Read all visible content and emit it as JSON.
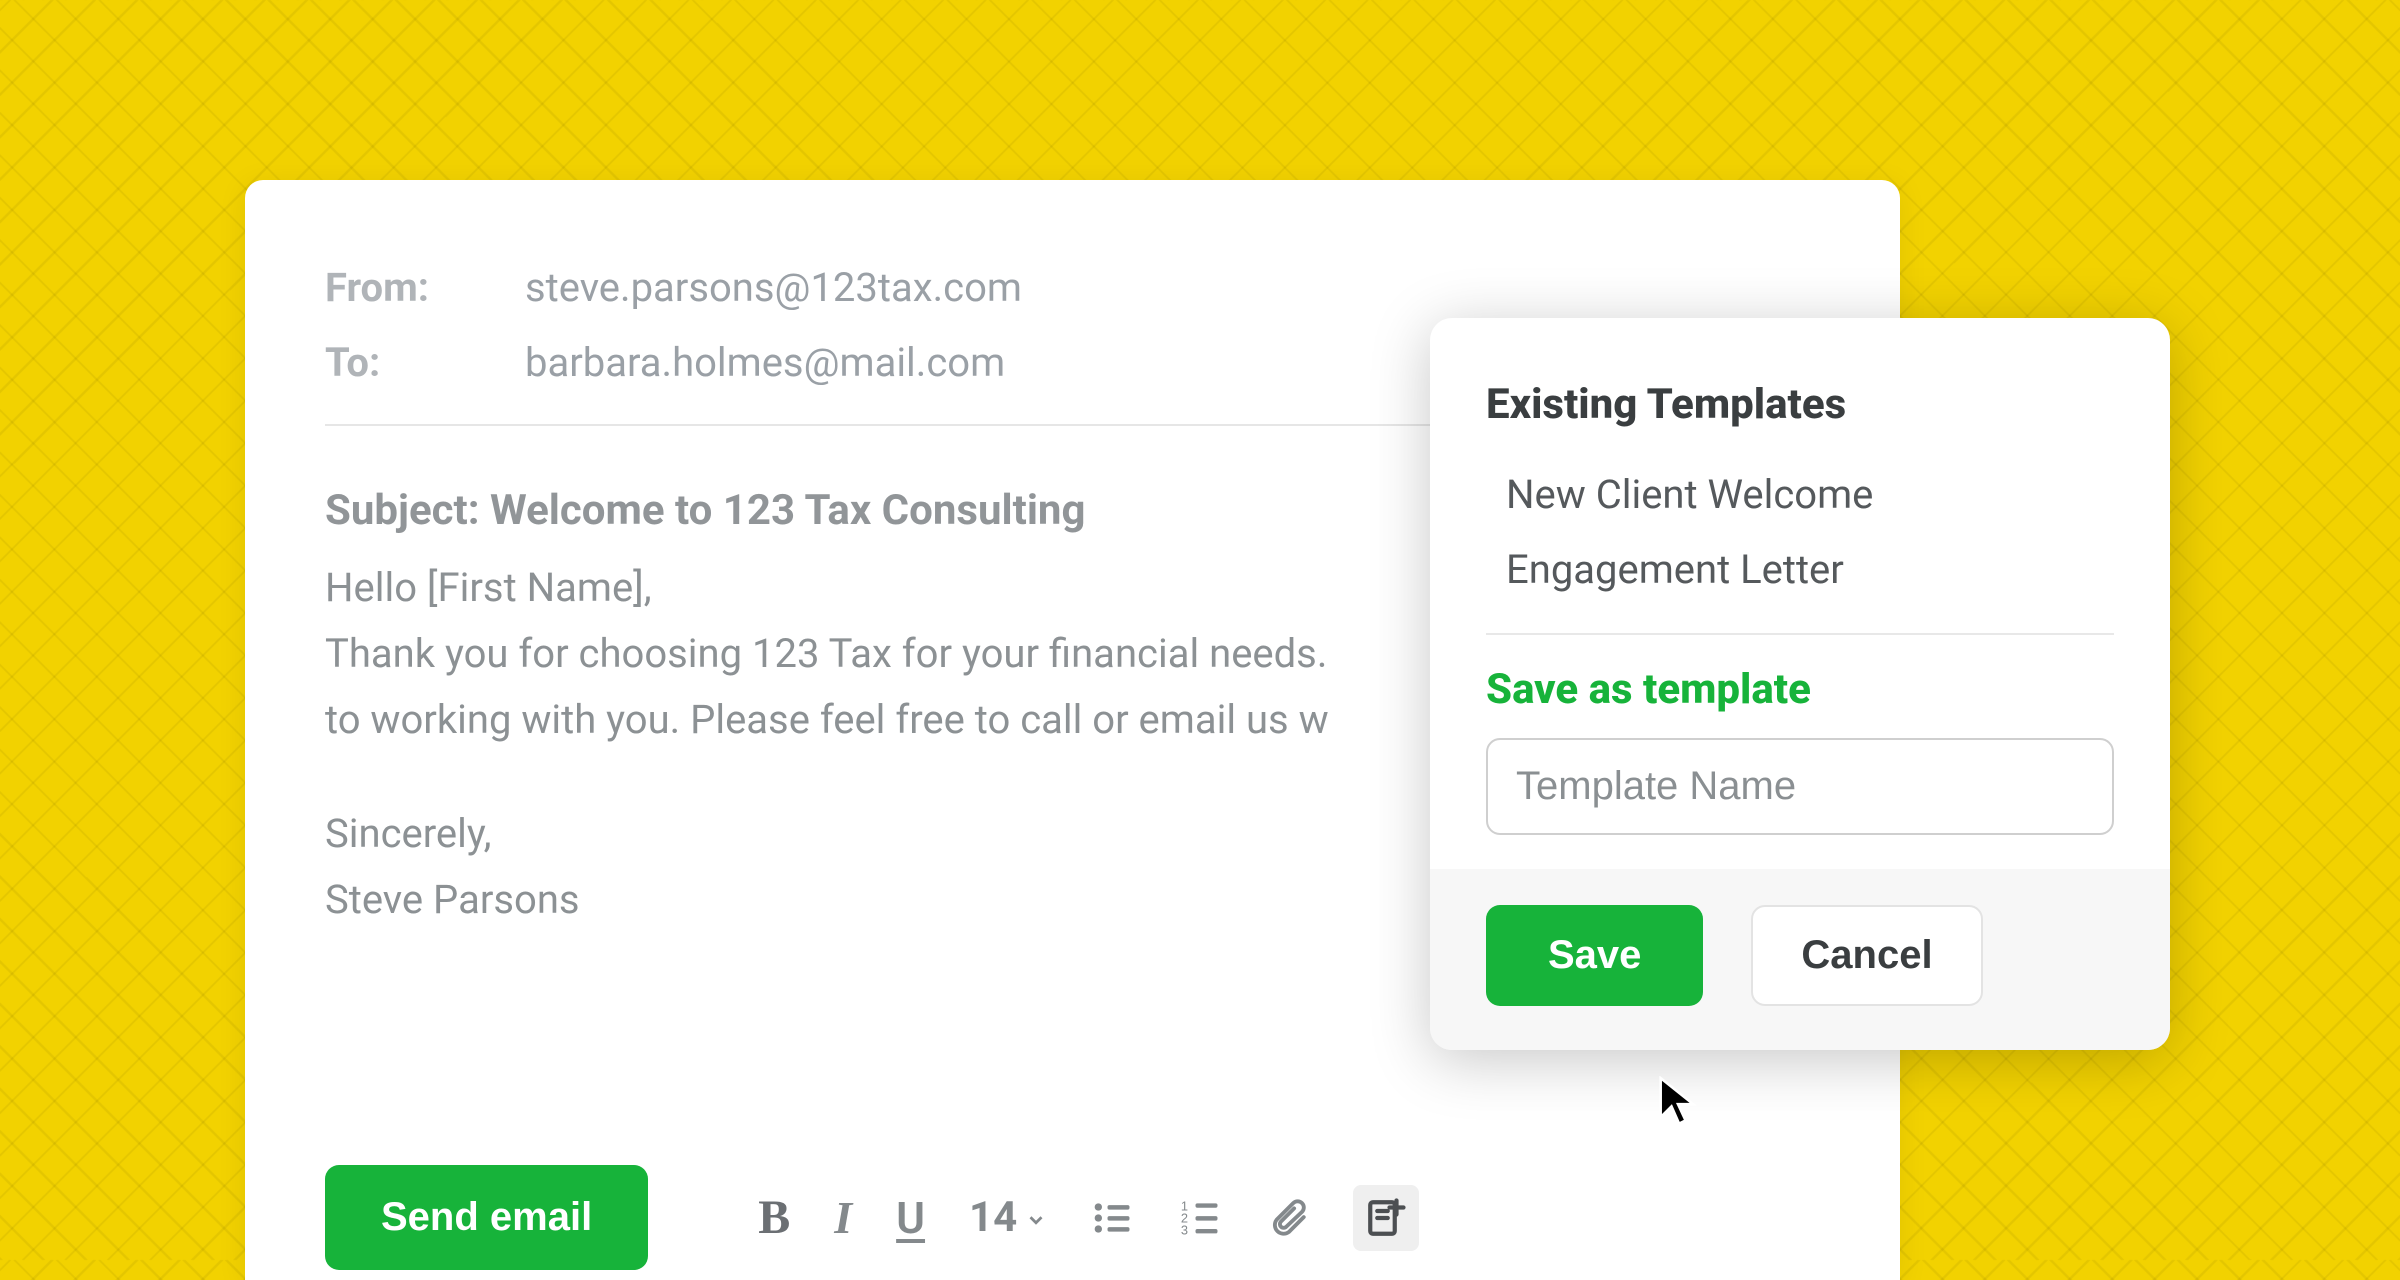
{
  "compose": {
    "from_label": "From:",
    "from_value": "steve.parsons@123tax.com",
    "to_label": "To:",
    "to_value": "barbara.holmes@mail.com",
    "subject_prefix": "Subject: ",
    "subject": "Welcome to 123 Tax Consulting",
    "body_line1": "Hello [First Name],",
    "body_line2": "Thank you for choosing 123 Tax for your financial needs.",
    "body_line3": "to working with you. Please feel free to call or email us w",
    "body_line4": "Sincerely,",
    "body_line5": "Steve Parsons",
    "send_label": "Send email",
    "font_size": "14"
  },
  "templates_popover": {
    "title": "Existing Templates",
    "items": [
      "New Client Welcome",
      "Engagement Letter"
    ],
    "save_as_label": "Save as template",
    "input_placeholder": "Template Name",
    "save_label": "Save",
    "cancel_label": "Cancel"
  },
  "colors": {
    "accent_green": "#17b33a",
    "bg_yellow": "#f2d200"
  }
}
